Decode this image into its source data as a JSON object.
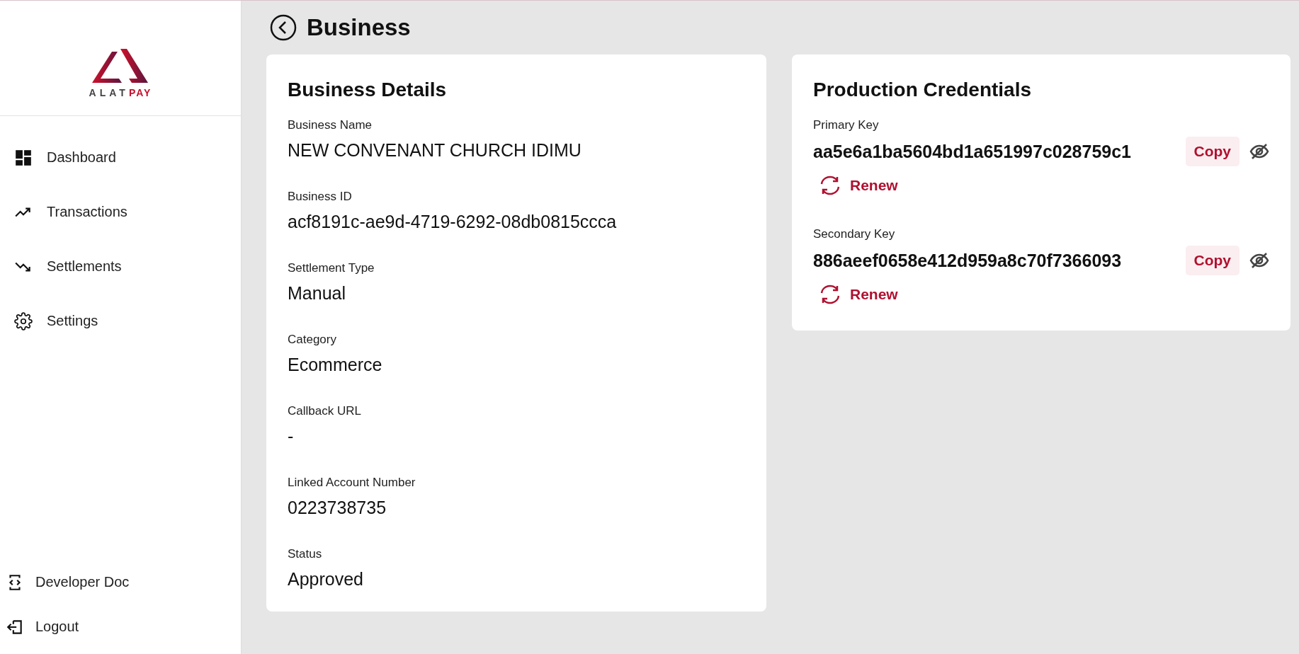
{
  "logo": {
    "prefix": "ALAT",
    "suffix": "PAY"
  },
  "sidebar": {
    "items": [
      {
        "label": "Dashboard",
        "kind": "dashboard"
      },
      {
        "label": "Transactions",
        "kind": "trend-up"
      },
      {
        "label": "Settlements",
        "kind": "trend-down"
      },
      {
        "label": "Settings",
        "kind": "settings"
      }
    ],
    "bottom_items": [
      {
        "label": "Developer Doc",
        "kind": "code"
      },
      {
        "label": "Logout",
        "kind": "logout"
      }
    ]
  },
  "page": {
    "title": "Business"
  },
  "business_details": {
    "title": "Business Details",
    "fields": [
      {
        "label": "Business Name",
        "value": "NEW CONVENANT CHURCH IDIMU"
      },
      {
        "label": "Business ID",
        "value": "acf8191c-ae9d-4719-6292-08db0815ccca"
      },
      {
        "label": "Settlement Type",
        "value": "Manual"
      },
      {
        "label": "Category",
        "value": "Ecommerce"
      },
      {
        "label": "Callback URL",
        "value": "-"
      },
      {
        "label": "Linked Account Number",
        "value": "0223738735"
      },
      {
        "label": "Status",
        "value": "Approved"
      }
    ]
  },
  "credentials": {
    "title": "Production Credentials",
    "keys": [
      {
        "label": "Primary Key",
        "value": "aa5e6a1ba5604bd1a651997c028759c1",
        "copy": "Copy",
        "renew": "Renew"
      },
      {
        "label": "Secondary Key",
        "value": "886aeef0658e412d959a8c70f7366093",
        "copy": "Copy",
        "renew": "Renew"
      }
    ]
  }
}
